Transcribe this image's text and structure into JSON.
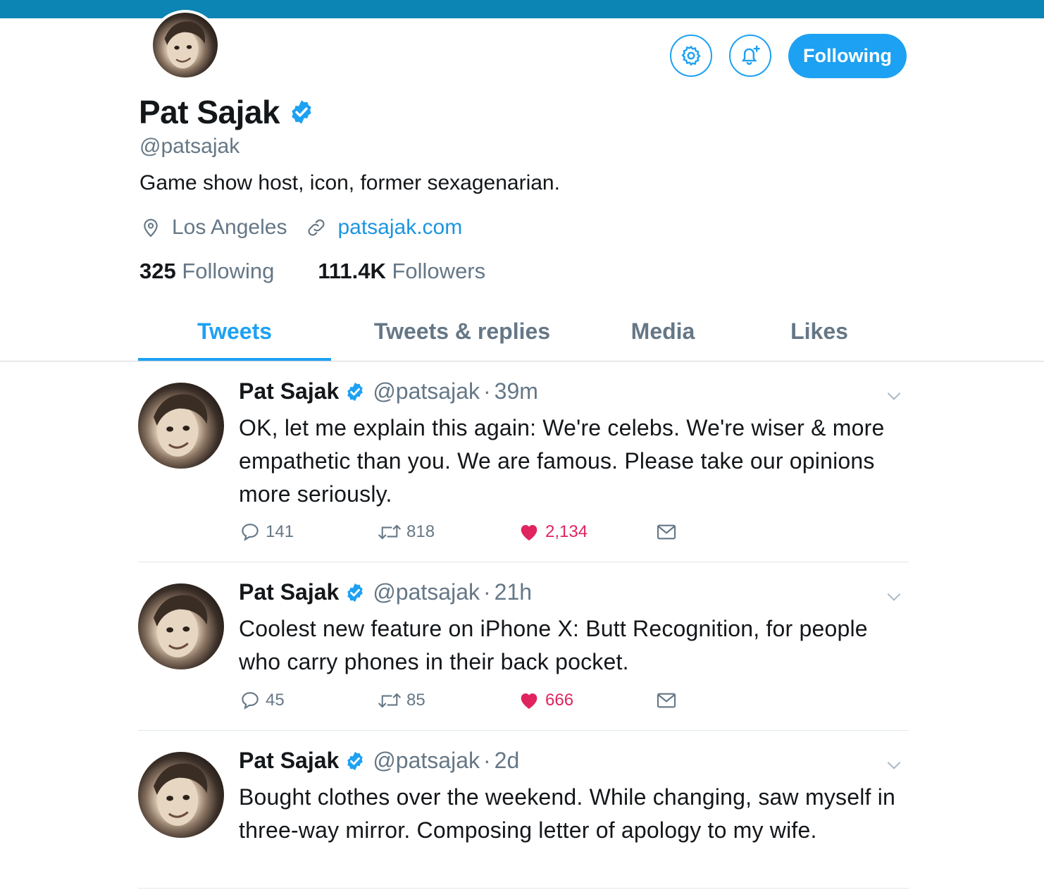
{
  "profile": {
    "name": "Pat Sajak",
    "handle": "@patsajak",
    "bio": "Game show host, icon, former sexagenarian.",
    "location": "Los Angeles",
    "website": "patsajak.com",
    "following_count": "325",
    "following_label": "Following",
    "followers_count": "111.4K",
    "followers_label": "Followers",
    "follow_button": "Following"
  },
  "icons": {
    "settings": "gear-icon",
    "notifications": "bell-plus-icon",
    "verified": "verified-badge-icon",
    "location": "location-pin-icon",
    "website": "link-icon",
    "reply": "reply-icon",
    "retweet": "retweet-icon",
    "like": "heart-icon",
    "dm": "envelope-icon",
    "more": "chevron-down-icon"
  },
  "tabs": [
    {
      "label": "Tweets",
      "active": true
    },
    {
      "label": "Tweets & replies",
      "active": false
    },
    {
      "label": "Media",
      "active": false
    },
    {
      "label": "Likes",
      "active": false
    }
  ],
  "tweets": [
    {
      "name": "Pat Sajak",
      "handle": "@patsajak",
      "time": "39m",
      "text": "OK, let me explain this again: We're celebs. We're wiser & more empathetic than you. We are famous. Please take our opinions more seriously.",
      "replies": "141",
      "retweets": "818",
      "likes": "2,134"
    },
    {
      "name": "Pat Sajak",
      "handle": "@patsajak",
      "time": "21h",
      "text": "Coolest new feature on iPhone X: Butt Recognition, for people who carry phones in their back pocket.",
      "replies": "45",
      "retweets": "85",
      "likes": "666"
    },
    {
      "name": "Pat Sajak",
      "handle": "@patsajak",
      "time": "2d",
      "text": "Bought clothes over the weekend. While changing, saw myself in three-way mirror. Composing letter of apology to my wife."
    }
  ],
  "colors": {
    "topbar": "#0c84b4",
    "accent": "#1da1f2",
    "link": "#1b95e0",
    "muted": "#657786",
    "like": "#e0245e"
  }
}
